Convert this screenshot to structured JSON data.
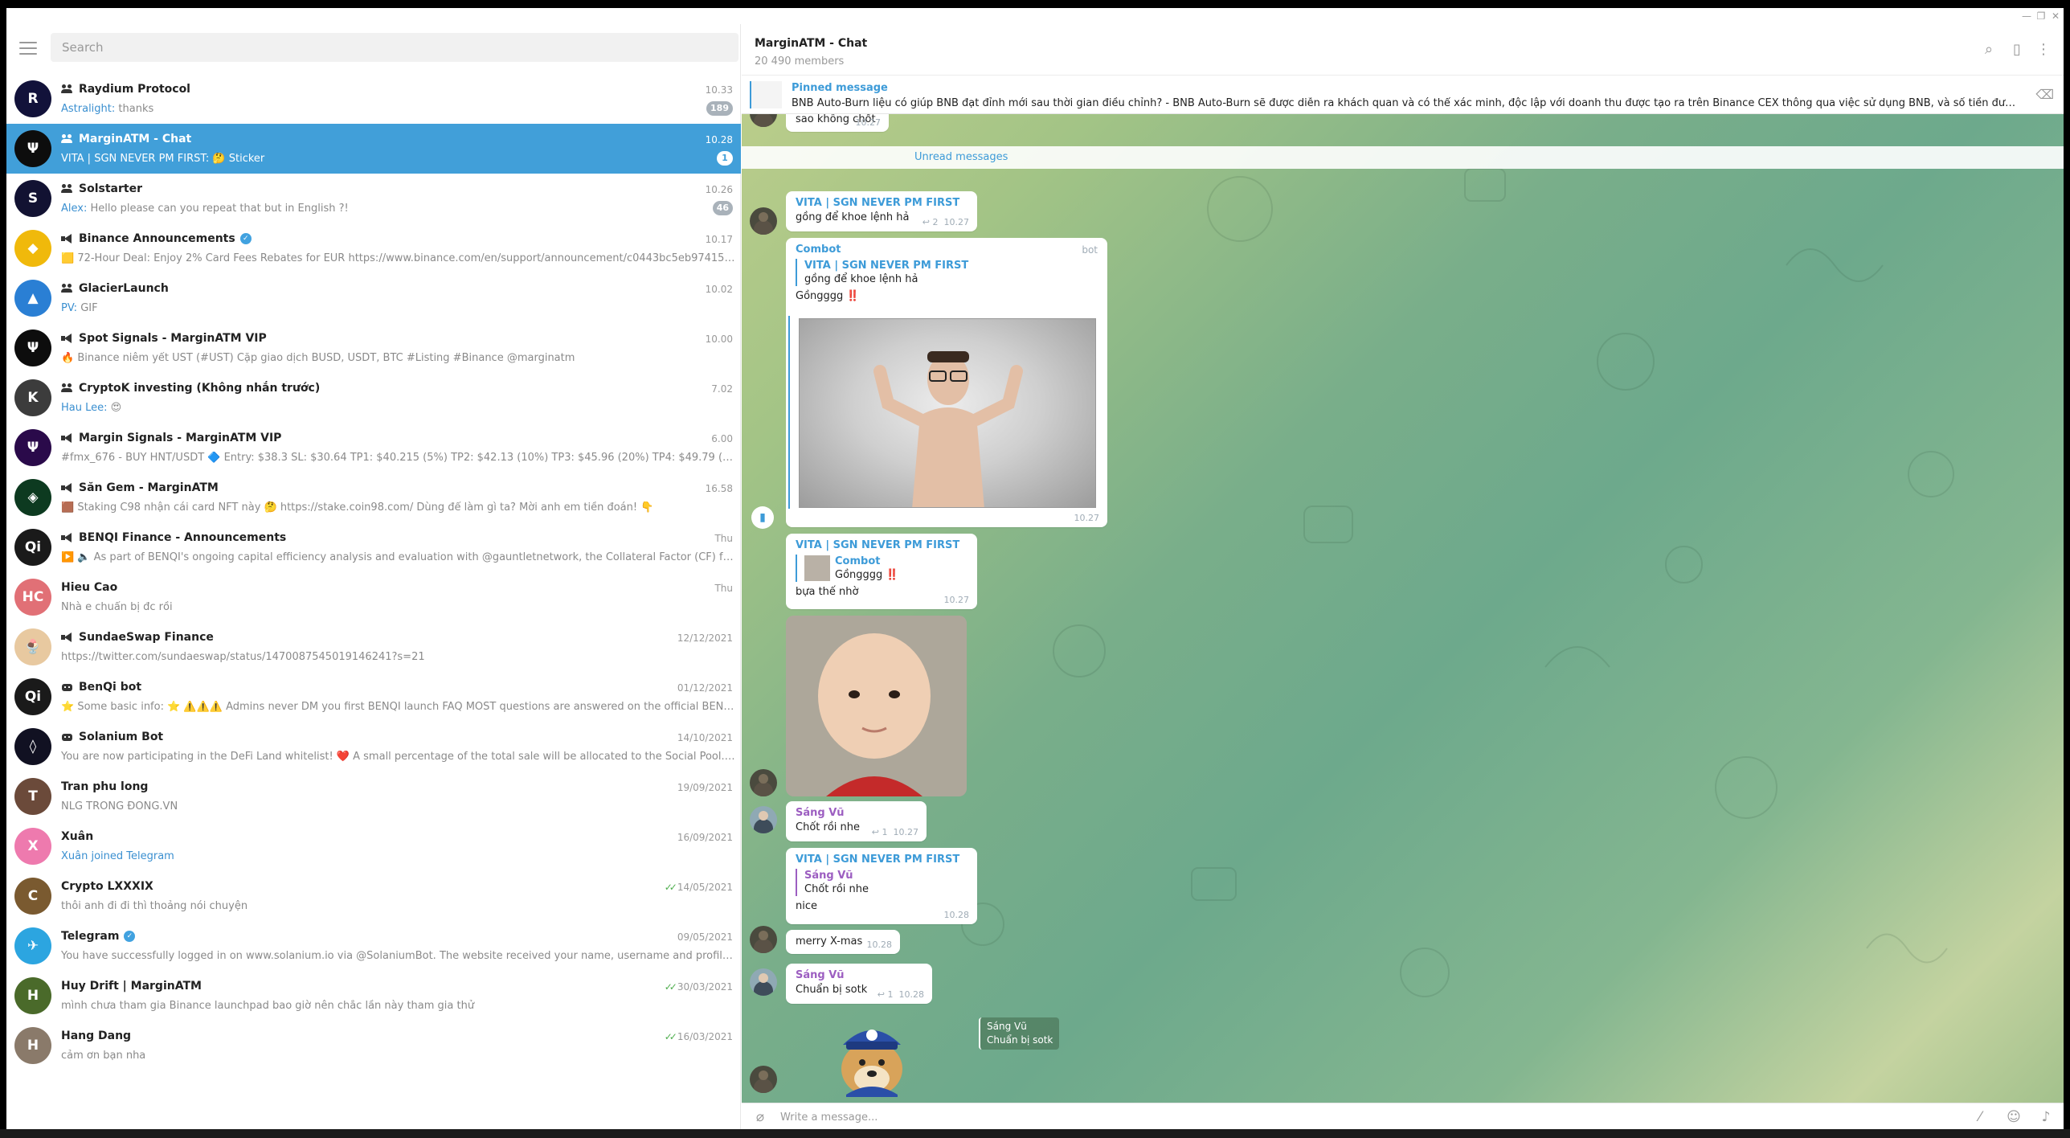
{
  "window": {
    "minimize_glyph": "—",
    "maximize_glyph": "❐",
    "close_glyph": "✕"
  },
  "search": {
    "placeholder": "Search"
  },
  "chats": [
    {
      "title": "Raydium Protocol",
      "kind": "group",
      "verified": false,
      "time": "10.33",
      "sender": "Astralight:",
      "preview": "thanks",
      "badge": "189",
      "active": false,
      "avatar_text": "R",
      "avatar_color": "#12123a"
    },
    {
      "title": "MarginATM - Chat",
      "kind": "group",
      "verified": false,
      "time": "10.28",
      "sender": "VITA | SGN NEVER PM FIRST:",
      "preview": "🤔 Sticker",
      "badge": "1",
      "active": true,
      "avatar_text": "Ψ",
      "avatar_color": "#0d0d0d"
    },
    {
      "title": "Solstarter",
      "kind": "group",
      "verified": false,
      "time": "10.26",
      "sender": "Alex:",
      "preview": "Hello please can you repeat that but in English ?!",
      "badge": "46",
      "active": false,
      "avatar_text": "S",
      "avatar_color": "#121232"
    },
    {
      "title": "Binance Announcements",
      "kind": "channel",
      "verified": true,
      "time": "10.17",
      "sender": "",
      "preview": "🟨 72-Hour Deal: Enjoy 2% Card Fees Rebates for EUR  https://www.binance.com/en/support/announcement/c0443bc5eb974157afb4fec28...",
      "badge": "",
      "active": false,
      "avatar_text": "◆",
      "avatar_color": "#f0b90b"
    },
    {
      "title": "GlacierLaunch",
      "kind": "group",
      "verified": false,
      "time": "10.02",
      "sender": "PV:",
      "preview": "GIF",
      "badge": "",
      "active": false,
      "avatar_text": "▲",
      "avatar_color": "#2a7fd4"
    },
    {
      "title": "Spot Signals - MarginATM VIP",
      "kind": "channel",
      "verified": false,
      "time": "10.00",
      "sender": "",
      "preview": "🔥 Binance niêm yết UST (#UST) Cặp giao dịch BUSD, USDT, BTC  #Listing #Binance @marginatm",
      "badge": "",
      "active": false,
      "avatar_text": "Ψ",
      "avatar_color": "#0d0d0d"
    },
    {
      "title": "CryptoK investing (Không nhắn trước)",
      "kind": "group",
      "verified": false,
      "time": "7.02",
      "sender": "Hau Lee:",
      "preview": "😍",
      "badge": "",
      "active": false,
      "avatar_text": "K",
      "avatar_color": "#3c3c3c"
    },
    {
      "title": "Margin Signals - MarginATM VIP",
      "kind": "channel",
      "verified": false,
      "time": "6.00",
      "sender": "",
      "preview": "#fmx_676 - BUY HNT/USDT 🔷  Entry: $38.3 SL: $30.64  TP1: $40.215 (5%) TP2: $42.13 (10%) TP3: $45.96 (20%) TP4: $49.79 (30%) TP5: $57.45 (...",
      "badge": "",
      "active": false,
      "avatar_text": "Ψ",
      "avatar_color": "#2a0a4a"
    },
    {
      "title": "Săn Gem - MarginATM",
      "kind": "channel",
      "verified": false,
      "time": "16.58",
      "sender": "",
      "preview": "🟫 Staking C98 nhận cái card NFT này 🤔  https://stake.coin98.com/  Dùng để làm gì ta? Mời anh em tiền đoán! 👇",
      "badge": "",
      "active": false,
      "avatar_text": "◈",
      "avatar_color": "#0d3a20"
    },
    {
      "title": "BENQI Finance - Announcements",
      "kind": "channel",
      "verified": false,
      "time": "Thu",
      "sender": "",
      "preview": "▶️ 🔈 As part of BENQI's ongoing capital efficiency analysis and evaluation with @gauntletnetwork, the Collateral Factor (CF) for $QI will be...",
      "badge": "",
      "active": false,
      "avatar_text": "Qi",
      "avatar_color": "#1a1a1a"
    },
    {
      "title": "Hieu Cao",
      "kind": "user",
      "verified": false,
      "time": "Thu",
      "sender": "",
      "preview": "Nhà e chuẩn bị đc rồi",
      "badge": "",
      "active": false,
      "avatar_text": "HC",
      "avatar_color": "#e17076"
    },
    {
      "title": "SundaeSwap Finance",
      "kind": "channel",
      "verified": false,
      "time": "12/12/2021",
      "sender": "",
      "preview": "https://twitter.com/sundaeswap/status/1470087545019146241?s=21",
      "badge": "",
      "active": false,
      "avatar_text": "🍨",
      "avatar_color": "#e8c9a0"
    },
    {
      "title": "BenQi bot",
      "kind": "bot",
      "verified": false,
      "time": "01/12/2021",
      "sender": "",
      "preview": "⭐ Some basic info: ⭐  ⚠️⚠️⚠️ Admins never DM you first  BENQI launch FAQ  MOST questions are answered on the official BENQI and ...",
      "badge": "",
      "active": false,
      "avatar_text": "Qi",
      "avatar_color": "#1a1a1a"
    },
    {
      "title": "Solanium Bot",
      "kind": "bot",
      "verified": false,
      "time": "14/10/2021",
      "sender": "",
      "preview": "You are now participating in the DeFi Land whitelist! ❤️  A small percentage of the total sale will be allocated to the Social Pool. You can ear...",
      "badge": "",
      "active": false,
      "avatar_text": "◊",
      "avatar_color": "#111122"
    },
    {
      "title": "Tran phu long",
      "kind": "user",
      "verified": false,
      "time": "19/09/2021",
      "sender": "",
      "preview": "NLG TRỐNG ĐỒNG.VN",
      "badge": "",
      "active": false,
      "avatar_text": "T",
      "avatar_color": "#6b4a3a"
    },
    {
      "title": "Xuân",
      "kind": "user",
      "verified": false,
      "time": "16/09/2021",
      "sender": "Xuân joined Telegram",
      "preview": "",
      "badge": "",
      "active": false,
      "avatar_text": "X",
      "avatar_color": "#ee7aae"
    },
    {
      "title": "Crypto LXXXIX",
      "kind": "user",
      "verified": false,
      "time": "14/05/2021",
      "sender": "",
      "preview": "thôi anh đi đi thì thoảng nói chuyện",
      "badge": "",
      "active": false,
      "avatar_text": "C",
      "avatar_color": "#7a5a30",
      "read": true
    },
    {
      "title": "Telegram",
      "kind": "user",
      "verified": true,
      "time": "09/05/2021",
      "sender": "",
      "preview": "You have successfully logged in on www.solanium.io via @SolaniumBot. The website received your name, username and profile picture. @S...",
      "badge": "",
      "active": false,
      "avatar_text": "✈",
      "avatar_color": "#2ca5e0"
    },
    {
      "title": "Huy Drift | MarginATM",
      "kind": "user",
      "verified": false,
      "time": "30/03/2021",
      "sender": "",
      "preview": "mình chưa tham gia Binance launchpad bao giờ nên chắc lần này tham gia thử",
      "badge": "",
      "active": false,
      "avatar_text": "H",
      "avatar_color": "#4a6a2a",
      "read": true
    },
    {
      "title": "Hang Dang",
      "kind": "user",
      "verified": false,
      "time": "16/03/2021",
      "sender": "",
      "preview": "cảm ơn bạn nha",
      "badge": "",
      "active": false,
      "avatar_text": "H",
      "avatar_color": "#8a7a6a",
      "read": true
    }
  ],
  "header": {
    "title": "MarginATM - Chat",
    "members": "20 490 members"
  },
  "pinned": {
    "label": "Pinned message",
    "text": "BNB Auto-Burn liệu có giúp BNB đạt đỉnh mới sau thời gian điều chỉnh?  - BNB Auto-Burn sẽ được diễn ra khách quan và có thể xác minh, độc lập với doanh thu được tạo ra trên Binance CEX thông qua việc sử dụng BNB, và số tiền được đốt sẽ được tự động ..."
  },
  "messages": {
    "m0": {
      "text": "sao không chốt",
      "time": "10.27"
    },
    "unread": "Unread messages",
    "m1": {
      "name": "VITA | SGN NEVER PM FIRST",
      "text": "gồng để khoe lệnh hả",
      "replies": "2",
      "time": "10.27"
    },
    "m2": {
      "name": "Combot",
      "tag": "bot",
      "reply_name": "VITA | SGN NEVER PM FIRST",
      "reply_text": "gồng để khoe lệnh hả",
      "text": "Gồngggg ‼️",
      "time": "10.27"
    },
    "m3": {
      "name": "VITA | SGN NEVER PM FIRST",
      "reply_name": "Combot",
      "reply_text": "Gồngggg ‼️",
      "text": "bựa thế nhờ",
      "time": "10.27"
    },
    "m4": {
      "name": "Sáng Vũ",
      "text": "Chốt rồi nhe",
      "replies": "1",
      "time": "10.27"
    },
    "m5": {
      "name": "VITA | SGN NEVER PM FIRST",
      "reply_name": "Sáng Vũ",
      "reply_text": "Chốt rồi nhe",
      "text": "nice",
      "time": "10.28"
    },
    "m6": {
      "text": "merry X-mas",
      "time": "10.28"
    },
    "m7": {
      "name": "Sáng Vũ",
      "text": "Chuẩn bị sotk",
      "replies": "1",
      "time": "10.28"
    },
    "m8": {
      "reply_name": "Sáng Vũ",
      "reply_text": "Chuẩn bị sotk"
    }
  },
  "composer": {
    "placeholder": "Write a message..."
  },
  "colors": {
    "accent": "#419fd9",
    "link": "#3d9bd8",
    "purple": "#9c5ec1"
  }
}
